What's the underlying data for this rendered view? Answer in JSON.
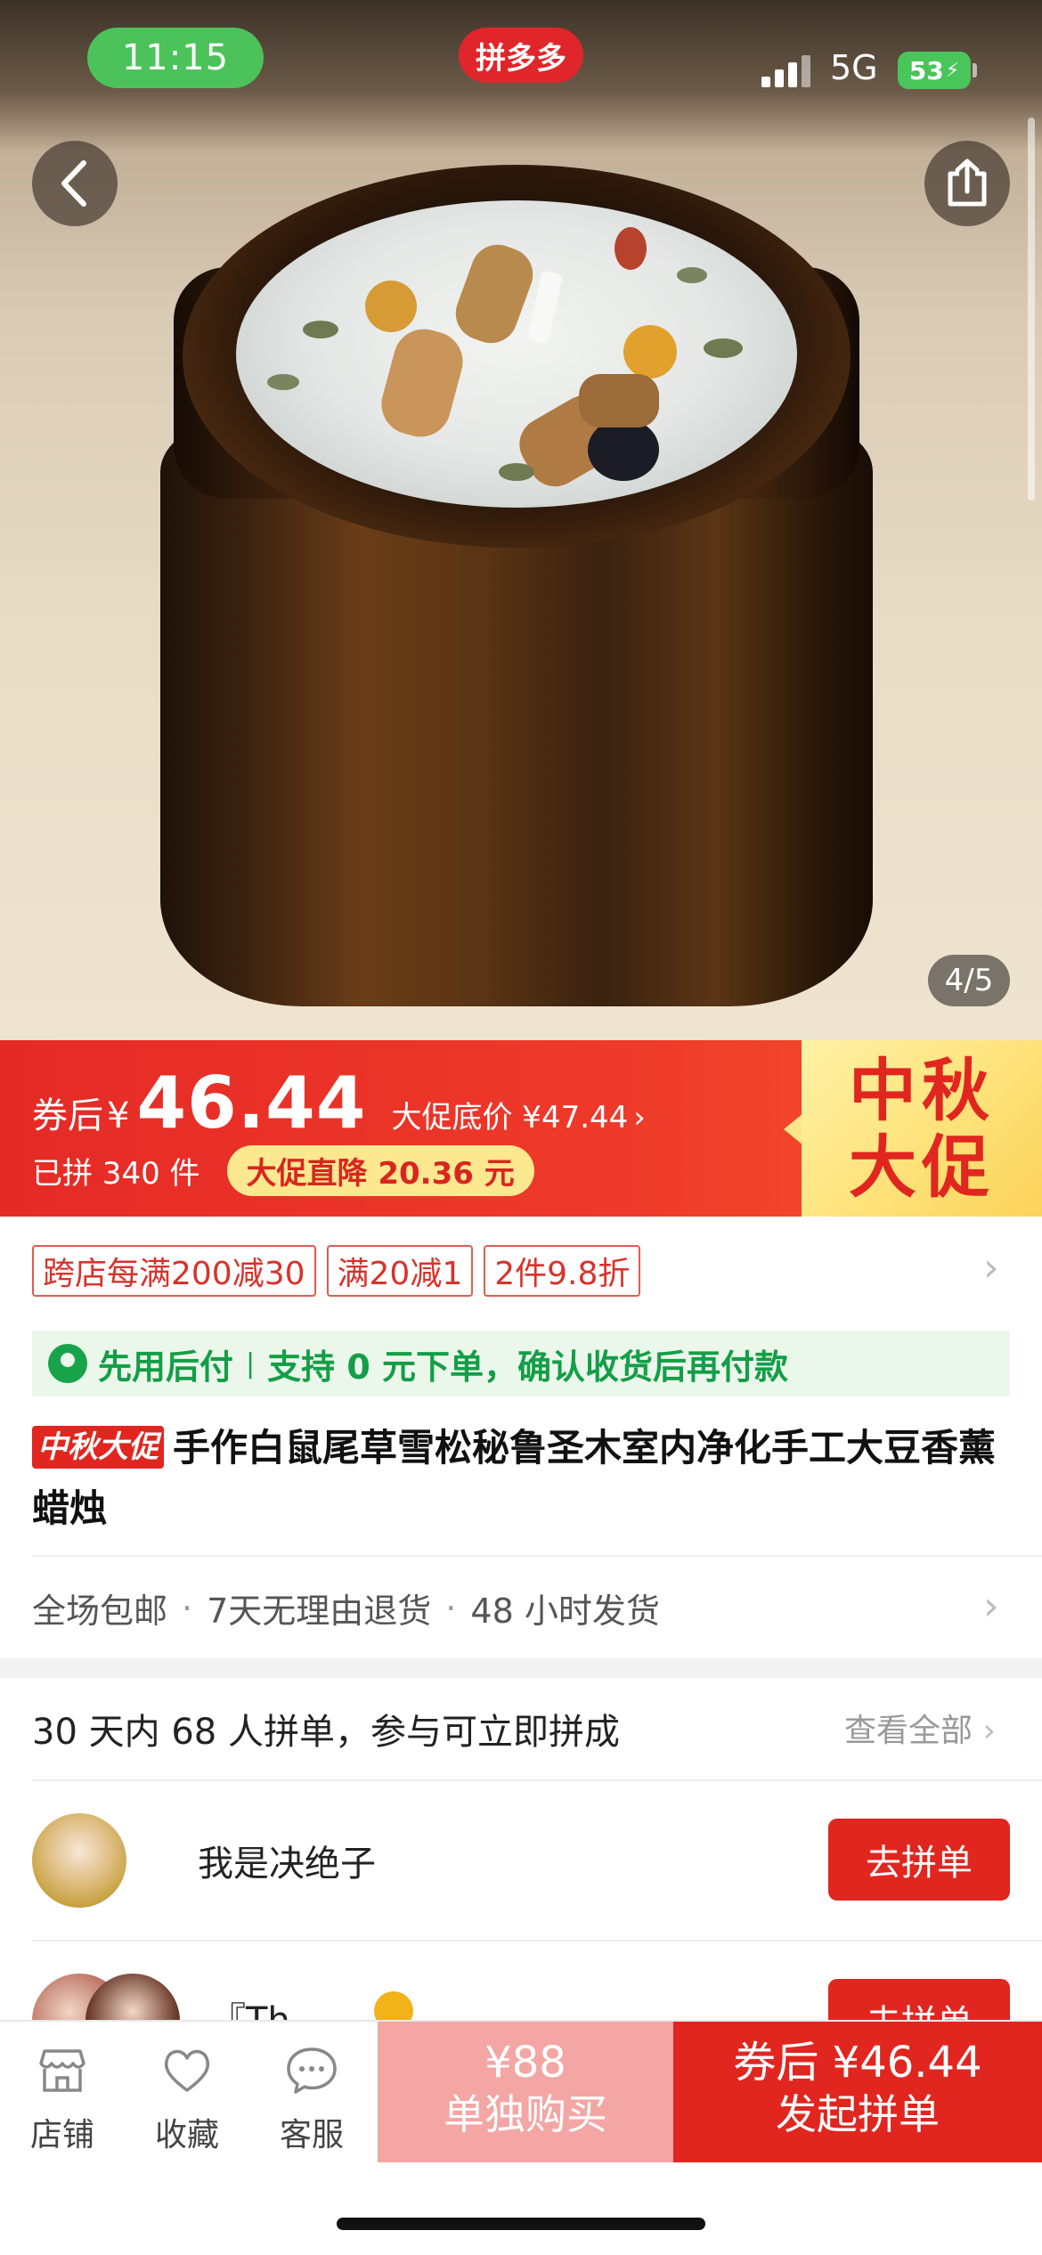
{
  "status_bar": {
    "time": "11:15",
    "app": "拼多多",
    "network": "5G",
    "battery": "53"
  },
  "gallery": {
    "counter": "4/5"
  },
  "price_band": {
    "coupon_label": "券后",
    "currency": "¥",
    "price": "46.44",
    "promo_low": "大促底价 ¥47.44",
    "promo_chevron": "›",
    "sold": "已拼 340 件",
    "drop": "大促直降 20.36 元",
    "festival_line1": "中秋",
    "festival_line2": "大促"
  },
  "coupons": [
    "跨店每满200减30",
    "满20减1",
    "2件9.8折"
  ],
  "bnpl": {
    "title": "先用后付",
    "sep": "|",
    "desc": "支持 0 元下单，确认收货后再付款"
  },
  "product": {
    "tag": "中秋大促",
    "title": "手作白鼠尾草雪松秘鲁圣木室内净化手工大豆香薰蜡烛"
  },
  "services": [
    "全场包邮",
    "7天无理由退货",
    "48 小时发货"
  ],
  "group_buy": {
    "headline": "30 天内 68 人拼单，参与可立即拼成",
    "see_all": "查看全部",
    "users": [
      {
        "name": "我是决绝子",
        "button": "去拼单"
      },
      {
        "name": "『Th",
        "button": "去拼单"
      }
    ]
  },
  "bottom_bar": {
    "tabs": [
      {
        "label": "店铺",
        "icon": "store-icon"
      },
      {
        "label": "收藏",
        "icon": "heart-icon"
      },
      {
        "label": "客服",
        "icon": "chat-icon"
      }
    ],
    "buy_alone_price": "¥88",
    "buy_alone_label": "单独购买",
    "buy_group_price": "券后 ¥46.44",
    "buy_group_label": "发起拼单"
  },
  "colors": {
    "brand_red": "#e0261f",
    "green": "#139e47",
    "festival_yellow": "#fde27a"
  }
}
